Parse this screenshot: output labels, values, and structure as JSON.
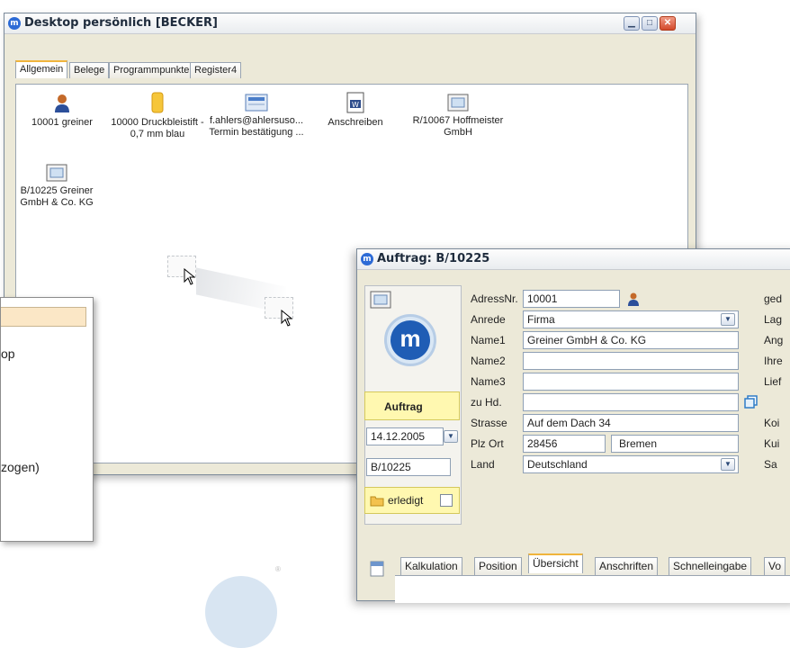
{
  "desktop_window": {
    "title": "Desktop persönlich [BECKER]",
    "tabs": [
      "Allgemein",
      "Belege",
      "Programmpunkte",
      "Register4"
    ],
    "items": [
      {
        "icon": "person-icon",
        "label1": "10001 greiner",
        "label2": ""
      },
      {
        "icon": "pencil-item-icon",
        "label1": "10000 Druckbleistift -",
        "label2": "0,7 mm  blau"
      },
      {
        "icon": "email-icon",
        "label1": "f.ahlers@ahlersuso...",
        "label2": "Termin bestätigung ..."
      },
      {
        "icon": "word-document-icon",
        "label1": "Anschreiben",
        "label2": ""
      },
      {
        "icon": "document-icon",
        "label1": "R/10067 Hoffmeister",
        "label2": "GmbH"
      },
      {
        "icon": "document-icon",
        "label1": "B/10225 Greiner",
        "label2": "GmbH & Co. KG"
      }
    ]
  },
  "popup": {
    "line1": "op",
    "line2": "zogen)"
  },
  "auftrag_window": {
    "title": "Auftrag: B/10225",
    "type_label": "Auftrag",
    "date": "14.12.2005",
    "number": "B/10225",
    "done_label": "erledigt",
    "fields": {
      "adress_label": "AdressNr.",
      "adress_value": "10001",
      "anrede_label": "Anrede",
      "anrede_value": "Firma",
      "name1_label": "Name1",
      "name1_value": "Greiner GmbH & Co. KG",
      "name2_label": "Name2",
      "name2_value": "",
      "name3_label": "Name3",
      "name3_value": "",
      "zuhd_label": "zu Hd.",
      "zuhd_value": "",
      "strasse_label": "Strasse",
      "strasse_value": "Auf dem Dach 34",
      "plzort_label": "Plz Ort",
      "plz_value": "28456",
      "ort_value": "Bremen",
      "land_label": "Land",
      "land_value": "Deutschland"
    },
    "right_labels": [
      "ged",
      "Lag",
      "Ang",
      "Ihre",
      "Lief",
      "Koi",
      "Kui",
      "Sa"
    ],
    "tabs": [
      "Kalkulation",
      "Position",
      "Übersicht",
      "Anschriften",
      "Schnelleingabe",
      "Vo"
    ]
  }
}
